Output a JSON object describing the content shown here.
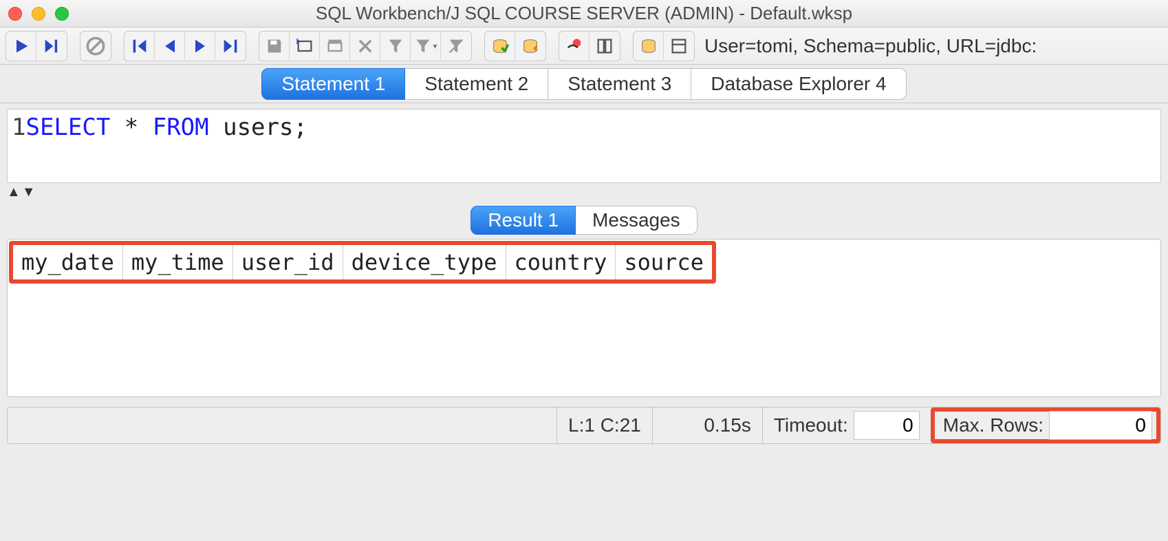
{
  "window": {
    "title": "SQL Workbench/J SQL COURSE SERVER (ADMIN) - Default.wksp"
  },
  "connection_info": "User=tomi, Schema=public, URL=jdbc:",
  "tabs": [
    {
      "label": "Statement 1",
      "active": true
    },
    {
      "label": "Statement 2",
      "active": false
    },
    {
      "label": "Statement 3",
      "active": false
    },
    {
      "label": "Database Explorer 4",
      "active": false
    }
  ],
  "editor": {
    "line_number": "1",
    "tokens": {
      "select": "SELECT",
      "star": " * ",
      "from": "FROM",
      "rest": " users;"
    }
  },
  "result_tabs": [
    {
      "label": "Result 1",
      "active": true
    },
    {
      "label": "Messages",
      "active": false
    }
  ],
  "result_columns": [
    "my_date",
    "my_time",
    "user_id",
    "device_type",
    "country",
    "source"
  ],
  "status": {
    "cursor": "L:1 C:21",
    "time": "0.15s",
    "timeout_label": "Timeout:",
    "timeout_value": "0",
    "maxrows_label": "Max. Rows:",
    "maxrows_value": "0"
  }
}
